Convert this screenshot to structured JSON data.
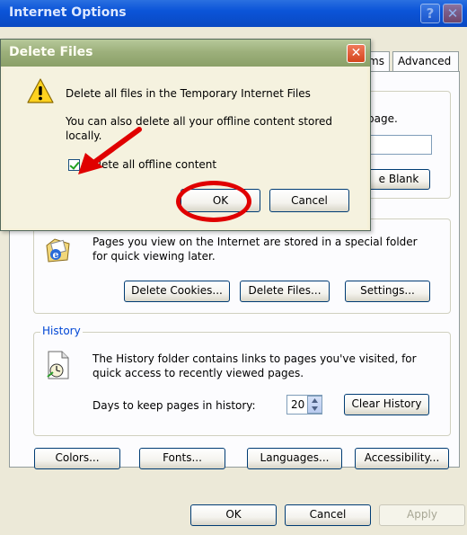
{
  "outer": {
    "title": "Internet Options",
    "help_glyph": "?",
    "close_glyph": "✕",
    "tabs": [
      {
        "label": "ms"
      },
      {
        "label": "Advanced"
      }
    ],
    "home_page": {
      "text_fragment": "page.",
      "use_blank_fragment": "e Blank"
    },
    "temp_files": {
      "text": "Pages you view on the Internet are stored in a special folder for quick viewing later.",
      "delete_cookies": "Delete Cookies...",
      "delete_files": "Delete Files...",
      "settings": "Settings..."
    },
    "history": {
      "legend": "History",
      "text": "The History folder contains links to pages you've visited, for quick access to recently viewed pages.",
      "days_label": "Days to keep pages in history:",
      "days_value": "20",
      "clear_history": "Clear History"
    },
    "bottom_row": {
      "colors": "Colors...",
      "fonts": "Fonts...",
      "languages": "Languages...",
      "accessibility": "Accessibility..."
    },
    "footer": {
      "ok": "OK",
      "cancel": "Cancel",
      "apply": "Apply"
    }
  },
  "dialog": {
    "title": "Delete Files",
    "close_glyph": "✕",
    "message_line1": "Delete all files in the Temporary Internet Files",
    "message_line2": "You can also delete all your offline content stored locally.",
    "checkbox_label": "Delete all offline content",
    "checkbox_checked": true,
    "ok": "OK",
    "cancel": "Cancel"
  },
  "annotations": {
    "arrow_color": "#e00000",
    "ring_color": "#e00000"
  }
}
